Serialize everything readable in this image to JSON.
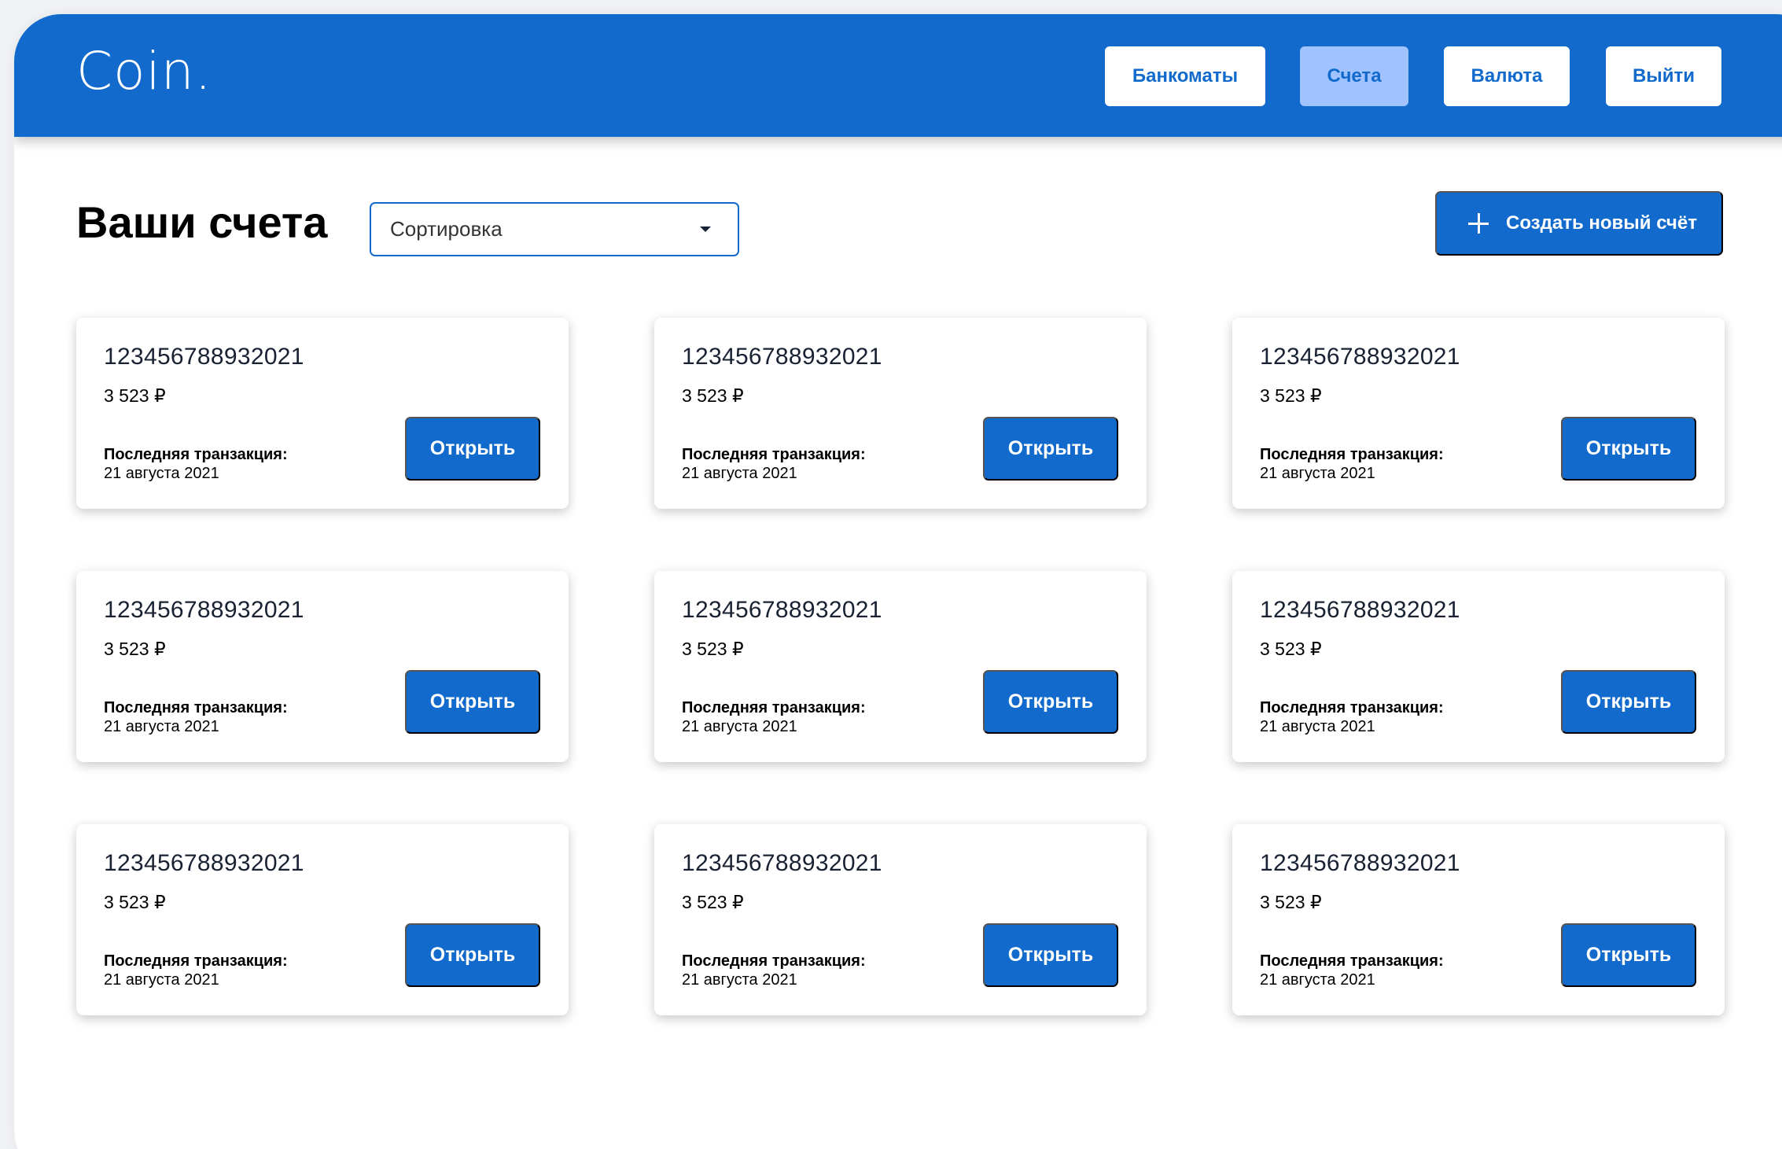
{
  "app": {
    "logo": "Coin."
  },
  "nav": {
    "atm_label": "Банкоматы",
    "accounts_label": "Счета",
    "currency_label": "Валюта",
    "logout_label": "Выйти",
    "active": "accounts"
  },
  "main": {
    "title": "Ваши счета",
    "sort": {
      "label": "Сортировка"
    },
    "create_button_label": "Создать новый счёт"
  },
  "colors": {
    "primary": "#116acc",
    "active_nav": "#a0c3ff",
    "text_dark": "#182233"
  },
  "accounts": [
    {
      "number": "123456788932021",
      "balance": "3 523 ₽",
      "last_tx_label": "Последняя транзакция:",
      "last_tx_date": "21 августа 2021",
      "open_label": "Открыть"
    },
    {
      "number": "123456788932021",
      "balance": "3 523 ₽",
      "last_tx_label": "Последняя транзакция:",
      "last_tx_date": "21 августа 2021",
      "open_label": "Открыть"
    },
    {
      "number": "123456788932021",
      "balance": "3 523 ₽",
      "last_tx_label": "Последняя транзакция:",
      "last_tx_date": "21 августа 2021",
      "open_label": "Открыть"
    },
    {
      "number": "123456788932021",
      "balance": "3 523 ₽",
      "last_tx_label": "Последняя транзакция:",
      "last_tx_date": "21 августа 2021",
      "open_label": "Открыть"
    },
    {
      "number": "123456788932021",
      "balance": "3 523 ₽",
      "last_tx_label": "Последняя транзакция:",
      "last_tx_date": "21 августа 2021",
      "open_label": "Открыть"
    },
    {
      "number": "123456788932021",
      "balance": "3 523 ₽",
      "last_tx_label": "Последняя транзакция:",
      "last_tx_date": "21 августа 2021",
      "open_label": "Открыть"
    },
    {
      "number": "123456788932021",
      "balance": "3 523 ₽",
      "last_tx_label": "Последняя транзакция:",
      "last_tx_date": "21 августа 2021",
      "open_label": "Открыть"
    },
    {
      "number": "123456788932021",
      "balance": "3 523 ₽",
      "last_tx_label": "Последняя транзакция:",
      "last_tx_date": "21 августа 2021",
      "open_label": "Открыть"
    },
    {
      "number": "123456788932021",
      "balance": "3 523 ₽",
      "last_tx_label": "Последняя транзакция:",
      "last_tx_date": "21 августа 2021",
      "open_label": "Открыть"
    }
  ]
}
